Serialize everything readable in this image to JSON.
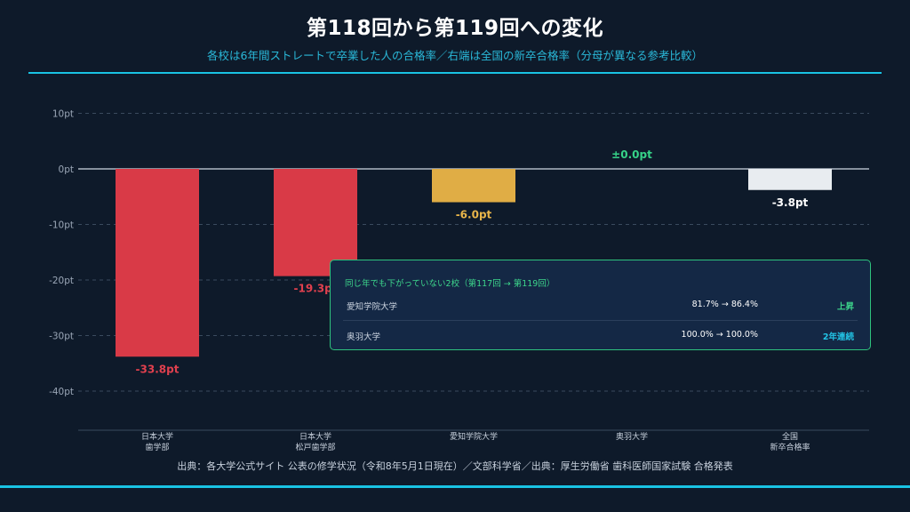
{
  "title": "第118回から第119回への変化",
  "subtitle": "各校は6年間ストレートで卒業した人の合格率／右端は全国の新卒合格率（分母が異なる参考比較）",
  "source": "出典：各大学公式サイト 公表の修学状況（令和8年5月1日現在）／文部科学省／出典：厚生労働省 歯科医師国家試験 合格発表",
  "colors": {
    "background": "#0e1a2a",
    "accent": "#19c3e3",
    "negative": "#d93a47",
    "warning": "#e0ad45",
    "national": "#e8ecf0",
    "positive": "#2ec27e"
  },
  "chart_data": {
    "type": "bar",
    "categories": [
      [
        "日本大学",
        "歯学部"
      ],
      [
        "日本大学",
        "松戸歯学部"
      ],
      [
        "愛知学院大学"
      ],
      [
        "奥羽大学"
      ],
      [
        "全国",
        "新卒合格率"
      ]
    ],
    "values": [
      -33.8,
      -19.3,
      -6.0,
      0.0,
      -3.8
    ],
    "data_labels": [
      "-33.8pt",
      "-19.3pt",
      "-6.0pt",
      "±0.0pt",
      "-3.8pt"
    ],
    "bar_colors": [
      "#d93a47",
      "#d93a47",
      "#e0ad45",
      "#2ec27e",
      "#e8ecf0"
    ],
    "label_colors": [
      "#e0404e",
      "#e0404e",
      "#e8b54a",
      "#36d388",
      "#ffffff"
    ],
    "yticks": [
      10,
      0,
      -10,
      -20,
      -30,
      -40
    ],
    "ytick_labels": [
      "10pt",
      "0pt",
      "-10pt",
      "-20pt",
      "-30pt",
      "-40pt"
    ],
    "ylim": [
      -47,
      12
    ],
    "grid": true
  },
  "panel": {
    "title": "同じ年でも下がっていない2校（第117回 → 第119回）",
    "rows": [
      {
        "school": "愛知学院大学",
        "change": "81.7% → 86.4%",
        "status": "上昇",
        "status_color": "#3dd68c"
      },
      {
        "school": "奥羽大学",
        "change": "100.0% → 100.0%",
        "status": "2年連続",
        "status_color": "#22c4e6"
      }
    ]
  }
}
